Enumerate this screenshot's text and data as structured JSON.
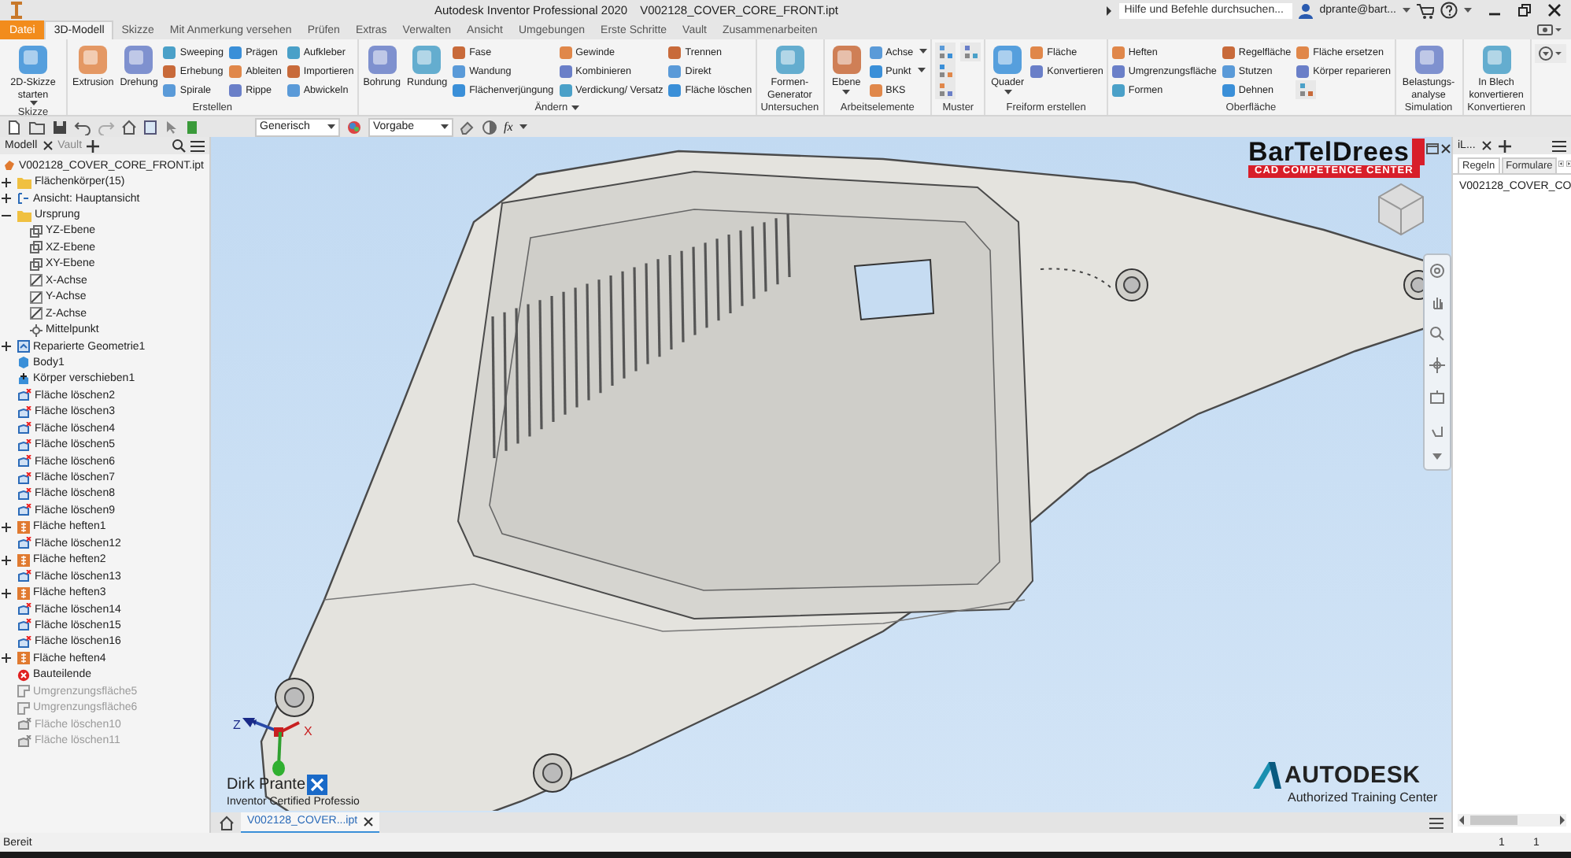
{
  "title_bar": {
    "app_title": "Autodesk Inventor Professional 2020",
    "document": "V002128_COVER_CORE_FRONT.ipt",
    "search": {
      "placeholder": "Hilfe und Befehle durchsuchen..."
    },
    "user": "dprante@bart..."
  },
  "ribbon_tabs": [
    {
      "label": "Datei",
      "kind": "file",
      "selected": false
    },
    {
      "label": "3D-Modell",
      "kind": "tab",
      "selected": true
    },
    {
      "label": "Skizze",
      "kind": "tab",
      "selected": false
    },
    {
      "label": "Mit Anmerkung versehen",
      "kind": "tab",
      "selected": false
    },
    {
      "label": "Prüfen",
      "kind": "tab",
      "selected": false
    },
    {
      "label": "Extras",
      "kind": "tab",
      "selected": false
    },
    {
      "label": "Verwalten",
      "kind": "tab",
      "selected": false
    },
    {
      "label": "Ansicht",
      "kind": "tab",
      "selected": false
    },
    {
      "label": "Umgebungen",
      "kind": "tab",
      "selected": false
    },
    {
      "label": "Erste Schritte",
      "kind": "tab",
      "selected": false
    },
    {
      "label": "Vault",
      "kind": "tab",
      "selected": false
    },
    {
      "label": "Zusammenarbeiten",
      "kind": "tab",
      "selected": false
    }
  ],
  "ribbon_panels": [
    {
      "title": "Skizze",
      "menu": false,
      "tools": [
        {
          "kind": "large",
          "label": "2D-Skizze starten",
          "dropdown": true
        }
      ]
    },
    {
      "title": "Erstellen",
      "menu": false,
      "tools": [
        {
          "kind": "large",
          "label": "Extrusion",
          "dropdown": false
        },
        {
          "kind": "large",
          "label": "Drehung",
          "dropdown": false
        },
        {
          "kind": "small",
          "label": "Sweeping",
          "dropdown": false
        },
        {
          "kind": "small",
          "label": "Erhebung",
          "dropdown": false
        },
        {
          "kind": "small",
          "label": "Spirale",
          "dropdown": false
        },
        {
          "kind": "small",
          "label": "Prägen",
          "dropdown": false
        },
        {
          "kind": "small",
          "label": "Ableiten",
          "dropdown": false
        },
        {
          "kind": "small",
          "label": "Rippe",
          "dropdown": false
        },
        {
          "kind": "small",
          "label": "Aufkleber",
          "dropdown": false
        },
        {
          "kind": "small",
          "label": "Importieren",
          "dropdown": false
        },
        {
          "kind": "small",
          "label": "Abwickeln",
          "dropdown": false
        }
      ]
    },
    {
      "title": "Ändern",
      "menu": true,
      "tools": [
        {
          "kind": "large",
          "label": "Bohrung",
          "dropdown": false
        },
        {
          "kind": "large",
          "label": "Rundung",
          "dropdown": false
        },
        {
          "kind": "small",
          "label": "Fase",
          "dropdown": false
        },
        {
          "kind": "small",
          "label": "Wandung",
          "dropdown": false
        },
        {
          "kind": "small",
          "label": "Flächenverjüngung",
          "dropdown": false
        },
        {
          "kind": "small",
          "label": "Gewinde",
          "dropdown": false
        },
        {
          "kind": "small",
          "label": "Kombinieren",
          "dropdown": false
        },
        {
          "kind": "small",
          "label": "Verdickung/ Versatz",
          "dropdown": false
        },
        {
          "kind": "small",
          "label": "Trennen",
          "dropdown": false
        },
        {
          "kind": "small",
          "label": "Direkt",
          "dropdown": false
        },
        {
          "kind": "small",
          "label": "Fläche löschen",
          "dropdown": false
        }
      ]
    },
    {
      "title": "Untersuchen",
      "menu": false,
      "tools": [
        {
          "kind": "large",
          "label": "Formen-Generator",
          "dropdown": false
        }
      ]
    },
    {
      "title": "Arbeitselemente",
      "menu": false,
      "tools": [
        {
          "kind": "large",
          "label": "Ebene",
          "dropdown": true
        },
        {
          "kind": "small",
          "label": "Achse",
          "dropdown": true
        },
        {
          "kind": "small",
          "label": "Punkt",
          "dropdown": true
        },
        {
          "kind": "small",
          "label": "BKS",
          "dropdown": false
        }
      ]
    },
    {
      "title": "Muster",
      "menu": false,
      "tools": [
        {
          "kind": "icon",
          "dropdown": false
        },
        {
          "kind": "icon",
          "dropdown": false
        },
        {
          "kind": "icon",
          "dropdown": false
        },
        {
          "kind": "icon",
          "dropdown": false
        }
      ]
    },
    {
      "title": "Freiform erstellen",
      "menu": false,
      "tools": [
        {
          "kind": "large",
          "label": "Quader",
          "dropdown": true
        },
        {
          "kind": "small",
          "label": "Fläche",
          "dropdown": false
        },
        {
          "kind": "small",
          "label": "Konvertieren",
          "dropdown": false
        }
      ]
    },
    {
      "title": "Oberfläche",
      "menu": false,
      "tools": [
        {
          "kind": "small",
          "label": "Heften",
          "dropdown": false
        },
        {
          "kind": "small",
          "label": "Umgrenzungsfläche",
          "dropdown": false
        },
        {
          "kind": "small",
          "label": "Formen",
          "dropdown": false
        },
        {
          "kind": "small",
          "label": "Regelfläche",
          "dropdown": false
        },
        {
          "kind": "small",
          "label": "Stutzen",
          "dropdown": false
        },
        {
          "kind": "small",
          "label": "Dehnen",
          "dropdown": false
        },
        {
          "kind": "small",
          "label": "Fläche ersetzen",
          "dropdown": false
        },
        {
          "kind": "small",
          "label": "Körper reparieren",
          "dropdown": false
        },
        {
          "kind": "icon",
          "dropdown": false
        }
      ]
    },
    {
      "title": "Simulation",
      "menu": false,
      "tools": [
        {
          "kind": "large",
          "label": "Belastungs-analyse",
          "dropdown": false
        }
      ]
    },
    {
      "title": "Konvertieren",
      "menu": false,
      "tools": [
        {
          "kind": "large",
          "label": "In Blech konvertieren",
          "dropdown": false
        }
      ]
    }
  ],
  "quick_access": {
    "material": "Generisch",
    "appearance": "Vorgabe",
    "formula": "fx"
  },
  "browser": {
    "tabs": [
      {
        "label": "Modell",
        "selected": true
      },
      {
        "label": "Vault",
        "selected": false
      }
    ],
    "tree": [
      {
        "label": "V002128_COVER_CORE_FRONT.ipt",
        "kind": "part",
        "suppressed": false,
        "children": [
          {
            "label": "Flächenkörper(15)",
            "kind": "folder",
            "suppressed": false,
            "expanded": false
          },
          {
            "label": "Ansicht: Hauptansicht",
            "kind": "view",
            "suppressed": false,
            "expanded": false
          },
          {
            "label": "Ursprung",
            "kind": "folder",
            "suppressed": false,
            "expanded": true,
            "children": [
              {
                "label": "YZ-Ebene",
                "kind": "plane",
                "suppressed": false
              },
              {
                "label": "XZ-Ebene",
                "kind": "plane",
                "suppressed": false
              },
              {
                "label": "XY-Ebene",
                "kind": "plane",
                "suppressed": false
              },
              {
                "label": "X-Achse",
                "kind": "axis",
                "suppressed": false
              },
              {
                "label": "Y-Achse",
                "kind": "axis",
                "suppressed": false
              },
              {
                "label": "Z-Achse",
                "kind": "axis",
                "suppressed": false
              },
              {
                "label": "Mittelpunkt",
                "kind": "point",
                "suppressed": false
              }
            ]
          },
          {
            "label": "Reparierte Geometrie1",
            "kind": "repair",
            "suppressed": false,
            "expanded": false
          },
          {
            "label": "Body1",
            "kind": "body",
            "suppressed": false
          },
          {
            "label": "Körper verschieben1",
            "kind": "move",
            "suppressed": false
          },
          {
            "label": "Fläche löschen2",
            "kind": "delete",
            "suppressed": false
          },
          {
            "label": "Fläche löschen3",
            "kind": "delete",
            "suppressed": false
          },
          {
            "label": "Fläche löschen4",
            "kind": "delete",
            "suppressed": false
          },
          {
            "label": "Fläche löschen5",
            "kind": "delete",
            "suppressed": false
          },
          {
            "label": "Fläche löschen6",
            "kind": "delete",
            "suppressed": false
          },
          {
            "label": "Fläche löschen7",
            "kind": "delete",
            "suppressed": false
          },
          {
            "label": "Fläche löschen8",
            "kind": "delete",
            "suppressed": false
          },
          {
            "label": "Fläche löschen9",
            "kind": "delete",
            "suppressed": false
          },
          {
            "label": "Fläche heften1",
            "kind": "stitch",
            "suppressed": false,
            "expanded": false
          },
          {
            "label": "Fläche löschen12",
            "kind": "delete",
            "suppressed": false
          },
          {
            "label": "Fläche heften2",
            "kind": "stitch",
            "suppressed": false,
            "expanded": false
          },
          {
            "label": "Fläche löschen13",
            "kind": "delete",
            "suppressed": false
          },
          {
            "label": "Fläche heften3",
            "kind": "stitch",
            "suppressed": false,
            "expanded": false
          },
          {
            "label": "Fläche löschen14",
            "kind": "delete",
            "suppressed": false
          },
          {
            "label": "Fläche löschen15",
            "kind": "delete",
            "suppressed": false
          },
          {
            "label": "Fläche löschen16",
            "kind": "delete",
            "suppressed": false
          },
          {
            "label": "Fläche heften4",
            "kind": "stitch",
            "suppressed": false,
            "expanded": false
          },
          {
            "label": "Bauteilende",
            "kind": "end",
            "suppressed": false
          },
          {
            "label": "Umgrenzungsfläche5",
            "kind": "boundary",
            "suppressed": true
          },
          {
            "label": "Umgrenzungsfläche6",
            "kind": "boundary",
            "suppressed": true
          },
          {
            "label": "Fläche löschen10",
            "kind": "delete",
            "suppressed": true
          },
          {
            "label": "Fläche löschen11",
            "kind": "delete",
            "suppressed": true
          }
        ]
      }
    ]
  },
  "viewport": {
    "logo": {
      "name": "BarTelDrees",
      "tagline": "CAD COMPETENCE CENTER"
    },
    "triad_labels": [
      "Z",
      "X"
    ],
    "certification": {
      "name": "Dirk Prante",
      "title": "Inventor Certified Professio"
    },
    "autodesk": {
      "brand": "AUTODESK",
      "subtitle": "Authorized Training Center"
    }
  },
  "document_tabs": [
    {
      "label": "V002128_COVER...ipt",
      "selected": true
    }
  ],
  "ilogic_panel": {
    "tab": "iL...",
    "subtabs": [
      {
        "label": "Regeln",
        "selected": true
      },
      {
        "label": "Formulare",
        "selected": false
      }
    ],
    "items": [
      "V002128_COVER_CO"
    ]
  },
  "status_bar": {
    "message": "Bereit",
    "values": [
      "1",
      "1"
    ]
  }
}
